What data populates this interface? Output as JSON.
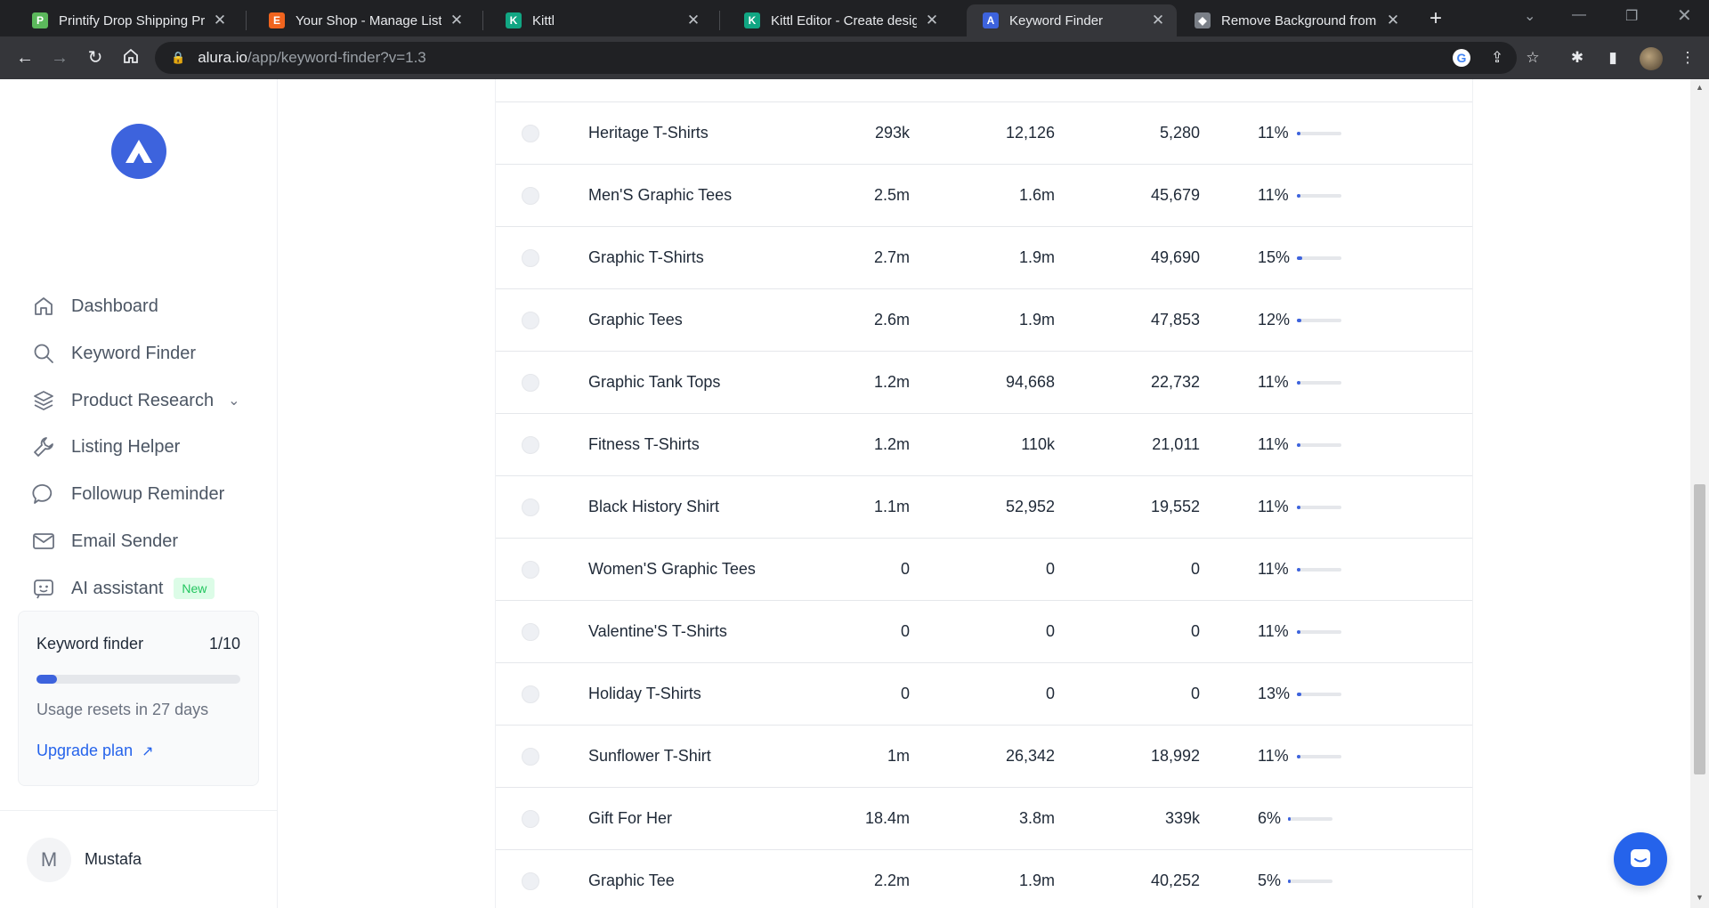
{
  "browser": {
    "tabs": [
      {
        "title": "Printify Drop Shipping Print",
        "favicon_color": "#5cb85c",
        "favicon_glyph": "P"
      },
      {
        "title": "Your Shop - Manage Listing",
        "favicon_color": "#f1641e",
        "favicon_glyph": "E"
      },
      {
        "title": "Kittl",
        "favicon_color": "#11a683",
        "favicon_glyph": "K"
      },
      {
        "title": "Kittl Editor - Create designs",
        "favicon_color": "#11a683",
        "favicon_glyph": "K"
      },
      {
        "title": "Keyword Finder",
        "favicon_color": "#3d63dd",
        "favicon_glyph": "A"
      },
      {
        "title": "Remove Background from I",
        "favicon_color": "#7a7f87",
        "favicon_glyph": "◆"
      }
    ],
    "active_tab": 4,
    "url_host": "alura.io",
    "url_path": "/app/keyword-finder?v=1.3"
  },
  "sidebar": {
    "nav": [
      {
        "label": "Dashboard",
        "icon": "home-icon"
      },
      {
        "label": "Keyword Finder",
        "icon": "search-icon"
      },
      {
        "label": "Product Research",
        "icon": "layers-icon"
      },
      {
        "label": "Listing Helper",
        "icon": "wrench-icon"
      },
      {
        "label": "Followup Reminder",
        "icon": "chat-bubble-icon"
      },
      {
        "label": "Email Sender",
        "icon": "mail-icon"
      },
      {
        "label": "AI assistant",
        "icon": "robot-icon"
      }
    ],
    "new_badge": "New",
    "usage": {
      "title": "Keyword finder",
      "count": "1/10",
      "used_fraction": 0.1,
      "reset_text": "Usage resets in 27 days",
      "upgrade_label": "Upgrade plan"
    },
    "user": {
      "initial": "M",
      "name": "Mustafa"
    }
  },
  "table": {
    "rows": [
      {
        "keyword": "Heritage T-Shirts",
        "c1": "293k",
        "c2": "12,126",
        "c3": "5,280",
        "pct": "11%",
        "pct_value": 11
      },
      {
        "keyword": "Men'S Graphic Tees",
        "c1": "2.5m",
        "c2": "1.6m",
        "c3": "45,679",
        "pct": "11%",
        "pct_value": 11
      },
      {
        "keyword": "Graphic T-Shirts",
        "c1": "2.7m",
        "c2": "1.9m",
        "c3": "49,690",
        "pct": "15%",
        "pct_value": 15
      },
      {
        "keyword": "Graphic Tees",
        "c1": "2.6m",
        "c2": "1.9m",
        "c3": "47,853",
        "pct": "12%",
        "pct_value": 12
      },
      {
        "keyword": "Graphic Tank Tops",
        "c1": "1.2m",
        "c2": "94,668",
        "c3": "22,732",
        "pct": "11%",
        "pct_value": 11
      },
      {
        "keyword": "Fitness T-Shirts",
        "c1": "1.2m",
        "c2": "110k",
        "c3": "21,011",
        "pct": "11%",
        "pct_value": 11
      },
      {
        "keyword": "Black History Shirt",
        "c1": "1.1m",
        "c2": "52,952",
        "c3": "19,552",
        "pct": "11%",
        "pct_value": 11
      },
      {
        "keyword": "Women'S Graphic Tees",
        "c1": "0",
        "c2": "0",
        "c3": "0",
        "pct": "11%",
        "pct_value": 11
      },
      {
        "keyword": "Valentine'S T-Shirts",
        "c1": "0",
        "c2": "0",
        "c3": "0",
        "pct": "11%",
        "pct_value": 11
      },
      {
        "keyword": "Holiday T-Shirts",
        "c1": "0",
        "c2": "0",
        "c3": "0",
        "pct": "13%",
        "pct_value": 13
      },
      {
        "keyword": "Sunflower T-Shirt",
        "c1": "1m",
        "c2": "26,342",
        "c3": "18,992",
        "pct": "11%",
        "pct_value": 11
      },
      {
        "keyword": "Gift For Her",
        "c1": "18.4m",
        "c2": "3.8m",
        "c3": "339k",
        "pct": "6%",
        "pct_value": 6
      },
      {
        "keyword": "Graphic Tee",
        "c1": "2.2m",
        "c2": "1.9m",
        "c3": "40,252",
        "pct": "5%",
        "pct_value": 5
      }
    ]
  },
  "colors": {
    "accent": "#3d63dd",
    "link": "#2563eb",
    "new_badge_bg": "#dcfce7",
    "new_badge_text": "#22c55e"
  }
}
